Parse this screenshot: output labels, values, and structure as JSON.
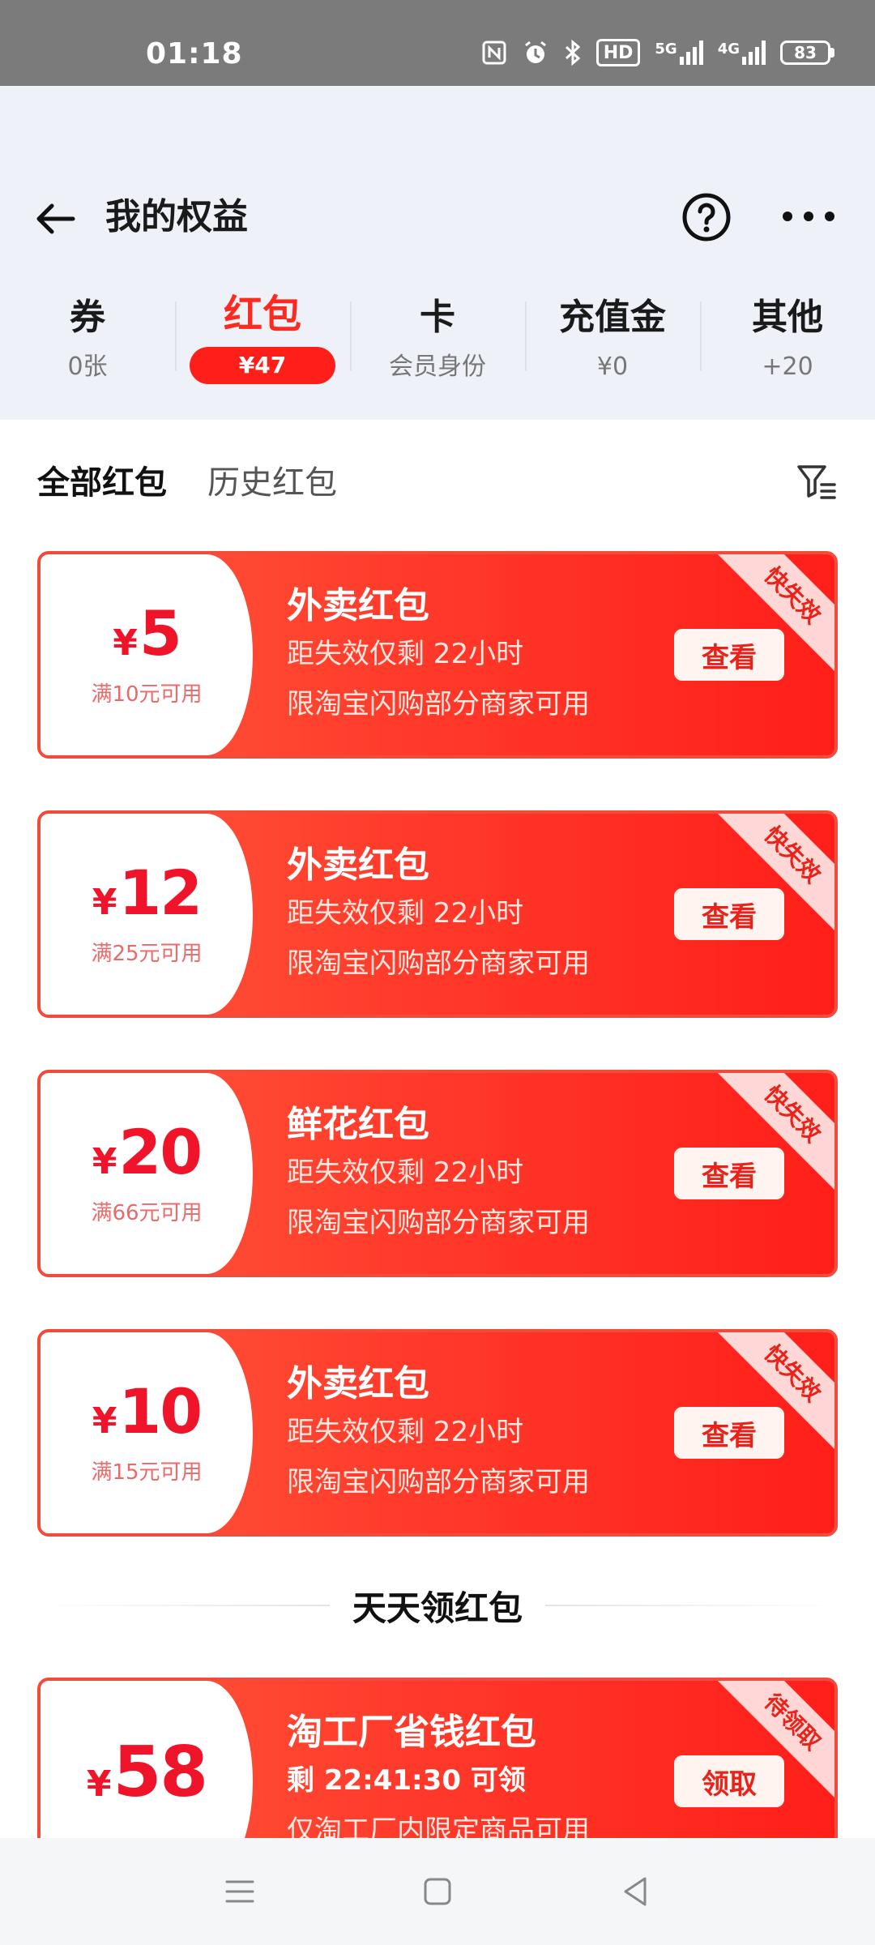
{
  "status_bar": {
    "time": "01:18",
    "icons": [
      "nfc-icon",
      "alarm-icon",
      "bluetooth-icon",
      "hd-icon",
      "signal-5g-icon",
      "signal-4g-icon"
    ],
    "hd_label": "HD",
    "net1": "5G",
    "net2": "4G",
    "battery": "83"
  },
  "header": {
    "title": "我的权益"
  },
  "tabs": [
    {
      "label": "券",
      "sub": "0张",
      "active": false
    },
    {
      "label": "红包",
      "sub": "¥47",
      "active": true
    },
    {
      "label": "卡",
      "sub": "会员身份",
      "active": false
    },
    {
      "label": "充值金",
      "sub": "¥0",
      "active": false
    },
    {
      "label": "其他",
      "sub": "+20",
      "active": false
    }
  ],
  "subtabs": [
    {
      "label": "全部红包",
      "active": true
    },
    {
      "label": "历史红包",
      "active": false
    }
  ],
  "coupons": [
    {
      "yen": "¥",
      "amount": "5",
      "condition": "满10元可用",
      "title": "外卖红包",
      "expire": "距失效仅剩 22小时",
      "desc": "限淘宝闪购部分商家可用",
      "button": "查看",
      "ribbon": "快失效"
    },
    {
      "yen": "¥",
      "amount": "12",
      "condition": "满25元可用",
      "title": "外卖红包",
      "expire": "距失效仅剩 22小时",
      "desc": "限淘宝闪购部分商家可用",
      "button": "查看",
      "ribbon": "快失效"
    },
    {
      "yen": "¥",
      "amount": "20",
      "condition": "满66元可用",
      "title": "鲜花红包",
      "expire": "距失效仅剩 22小时",
      "desc": "限淘宝闪购部分商家可用",
      "button": "查看",
      "ribbon": "快失效"
    },
    {
      "yen": "¥",
      "amount": "10",
      "condition": "满15元可用",
      "title": "外卖红包",
      "expire": "距失效仅剩 22小时",
      "desc": "限淘宝闪购部分商家可用",
      "button": "查看",
      "ribbon": "快失效"
    }
  ],
  "section": {
    "title": "天天领红包"
  },
  "claim_coupon": {
    "yen": "¥",
    "amount": "58",
    "title": "淘工厂省钱红包",
    "expire": "剩 22:41:30  可领",
    "desc": "仅淘工厂内限定商品可用",
    "button": "领取",
    "ribbon": "待领取"
  },
  "colors": {
    "accent": "#ff1f1a",
    "header_bg": "#eef2f8"
  }
}
